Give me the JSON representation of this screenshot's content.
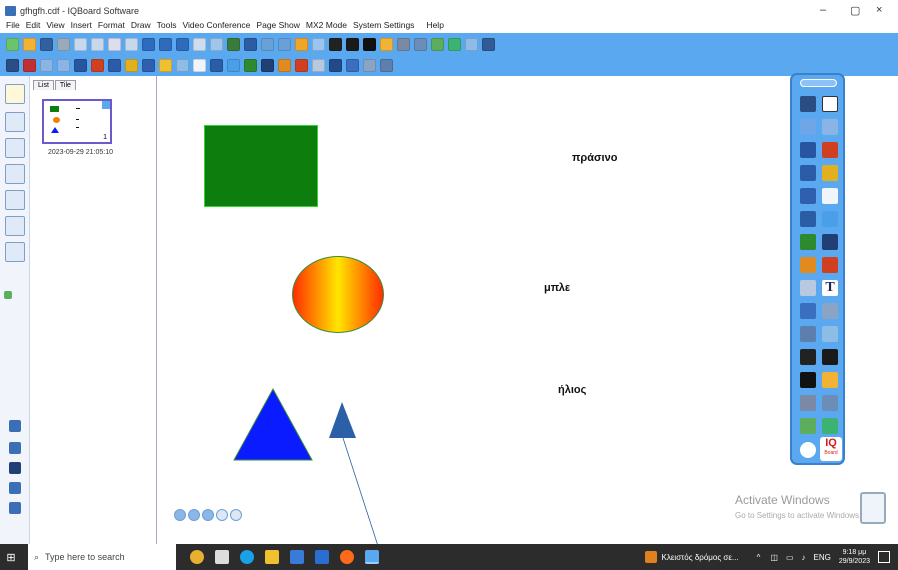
{
  "window": {
    "title": "gfhgfh.cdf - IQBoard Software",
    "minimize": "–",
    "maximize": "▢",
    "close": "×"
  },
  "menu": [
    "File",
    "Edit",
    "View",
    "Insert",
    "Format",
    "Draw",
    "Tools",
    "Video Conference",
    "Page Show",
    "MX2 Mode",
    "System Settings",
    "Help"
  ],
  "panel": {
    "tabs": [
      "List",
      "Tile"
    ],
    "page_number": "1",
    "page_date": "2023-09-29 21:05:10"
  },
  "canvas": {
    "labels": [
      "πράσινο",
      "μπλε",
      "ήλιος"
    ],
    "colors": {
      "green": "#0d7d0d",
      "blue": "#0a1cff",
      "yellow": "#ffe600",
      "red": "#ff2d00",
      "arrow": "#2b5fa8"
    }
  },
  "floatbar": {
    "t_tool": "T",
    "brand": "IQ",
    "brand_sub": "Board"
  },
  "watermark": {
    "title": "Activate Windows",
    "subtitle": "Go to Settings to activate Windows."
  },
  "taskbar": {
    "search_placeholder": "Type here to search",
    "notification": "Κλειστός δρόμος σε...",
    "lang": "ENG",
    "time": "9:18 μμ",
    "date": "29/9/2023"
  }
}
